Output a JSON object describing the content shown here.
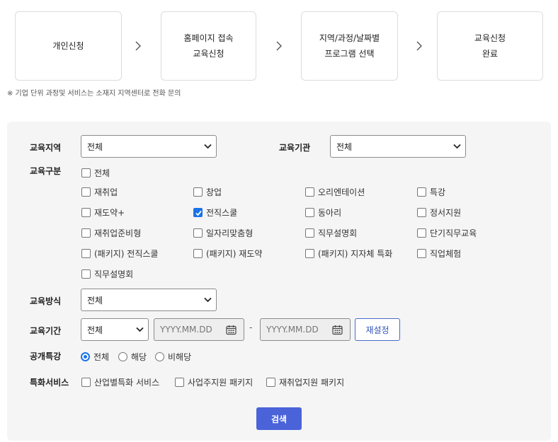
{
  "steps": [
    {
      "line1": "개인신청",
      "line2": ""
    },
    {
      "line1": "홈페이지 접속",
      "line2": "교육신청"
    },
    {
      "line1": "지역/과정/날짜별",
      "line2": "프로그램 선택"
    },
    {
      "line1": "교육신청",
      "line2": "완료"
    }
  ],
  "notice": "※ 기업 단위 과정및 서비스는 소재지 지역센터로 전화 문의",
  "form": {
    "region": {
      "label": "교육지역",
      "value": "전체"
    },
    "institution": {
      "label": "교육기관",
      "value": "전체"
    },
    "category": {
      "label": "교육구분",
      "all": {
        "label": "전체",
        "checked": false
      },
      "options": [
        {
          "label": "재취업",
          "checked": false
        },
        {
          "label": "창업",
          "checked": false
        },
        {
          "label": "오리엔테이션",
          "checked": false
        },
        {
          "label": "특강",
          "checked": false
        },
        {
          "label": "재도약+",
          "checked": false
        },
        {
          "label": "전직스쿨",
          "checked": true
        },
        {
          "label": "동아리",
          "checked": false
        },
        {
          "label": "정서지원",
          "checked": false
        },
        {
          "label": "재취업준비형",
          "checked": false
        },
        {
          "label": "일자리맞춤형",
          "checked": false
        },
        {
          "label": "직무설명회",
          "checked": false
        },
        {
          "label": "단기직무교육",
          "checked": false
        },
        {
          "label": "(패키지) 전직스쿨",
          "checked": false
        },
        {
          "label": "(패키지) 재도약",
          "checked": false
        },
        {
          "label": "(패키지) 지자체 특화",
          "checked": false
        },
        {
          "label": "직업체험",
          "checked": false
        },
        {
          "label": "직무설명회",
          "checked": false
        }
      ]
    },
    "method": {
      "label": "교육방식",
      "value": "전체"
    },
    "period": {
      "label": "교육기간",
      "value": "전체",
      "start_placeholder": "YYYY.MM.DD",
      "separator": "-",
      "end_placeholder": "YYYY.MM.DD",
      "reset_label": "재설정"
    },
    "public_lecture": {
      "label": "공개특강",
      "options": [
        {
          "label": "전체",
          "selected": true
        },
        {
          "label": "해당",
          "selected": false
        },
        {
          "label": "비해당",
          "selected": false
        }
      ]
    },
    "special_service": {
      "label": "특화서비스",
      "options": [
        {
          "label": "산업별특화 서비스",
          "checked": false
        },
        {
          "label": "사업주지원 패키지",
          "checked": false
        },
        {
          "label": "재취업지원 패키지",
          "checked": false
        }
      ]
    },
    "search_label": "검색"
  },
  "colors": {
    "accent": "#1a73e8",
    "button": "#4a63d9",
    "panel": "#f5f5f5"
  },
  "icons": {
    "step_separator": "chevron-right-icon",
    "select": "chevron-down-icon",
    "date": "calendar-icon"
  }
}
